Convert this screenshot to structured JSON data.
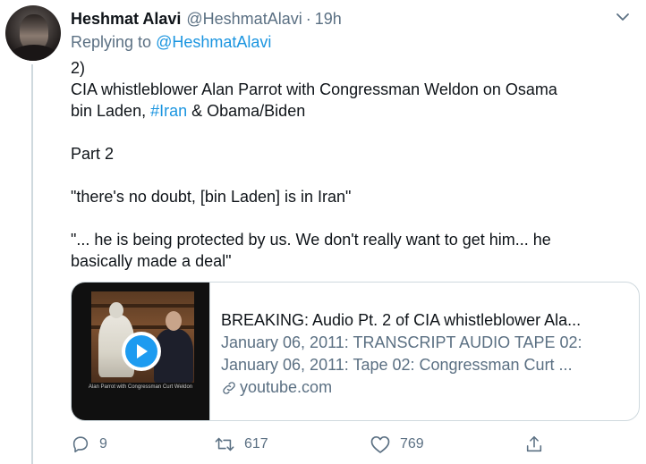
{
  "author": {
    "display_name": "Heshmat Alavi",
    "handle": "@HeshmatAlavi",
    "separator": "·",
    "time": "19h"
  },
  "replying": {
    "prefix": "Replying to",
    "handle": "@HeshmatAlavi"
  },
  "body": {
    "line1": "2)",
    "line2": "CIA whistleblower Alan Parrot with Congressman Weldon on Osama",
    "line3_pre": "bin Laden,",
    "line3_hashtag": "#Iran",
    "line3_post": "& Obama/Biden",
    "line4": "Part 2",
    "line5": "\"there's no doubt, [bin Laden] is in Iran\"",
    "line6": "\"... he is being protected by us. We don't really want to get him... he",
    "line7": "basically made a deal\""
  },
  "card": {
    "thumbnail_caption": "Alan Parrot with Congressman Curt Weldon",
    "title": "BREAKING: Audio Pt. 2 of CIA whistleblower Ala...",
    "desc_line1": "January 06, 2011: TRANSCRIPT AUDIO TAPE 02:",
    "desc_line2": "January 06, 2011: Tape 02: Congressman Curt ...",
    "domain": "youtube.com"
  },
  "actions": {
    "reply_count": "9",
    "retweet_count": "617",
    "like_count": "769"
  },
  "icons": {
    "more": "chevron-down-icon",
    "reply": "reply-icon",
    "retweet": "retweet-icon",
    "like": "heart-icon",
    "share": "share-icon",
    "link": "link-icon",
    "play": "play-icon"
  },
  "colors": {
    "link": "#1b95e0",
    "secondary_text": "#5b7083",
    "play_button": "#1d9bf0",
    "border": "#cfd9de"
  }
}
